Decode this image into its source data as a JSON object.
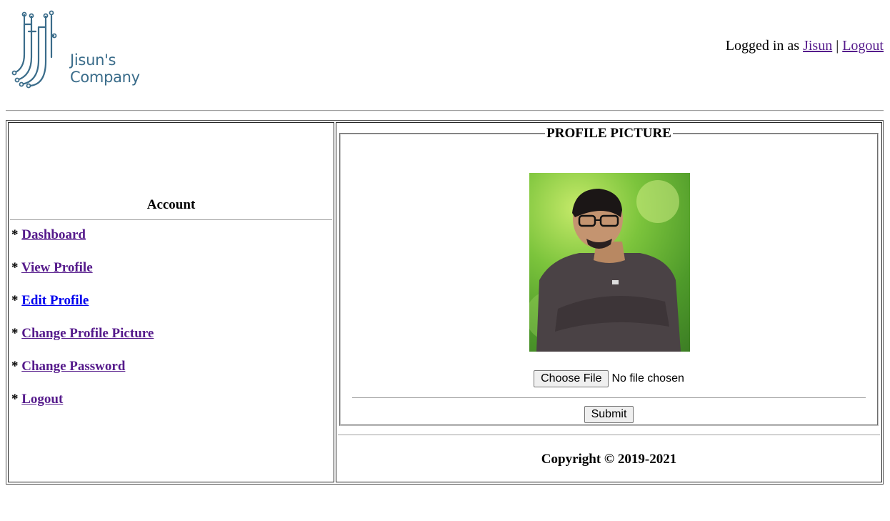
{
  "header": {
    "company_name": "Jisun's Company",
    "logged_in_prefix": "Logged in as",
    "username": "Jisun",
    "separator": "|",
    "logout_label": "Logout"
  },
  "sidebar": {
    "title": "Account",
    "bullet": "*",
    "items": [
      {
        "label": "Dashboard"
      },
      {
        "label": "View Profile"
      },
      {
        "label": "Edit Profile"
      },
      {
        "label": "Change Profile Picture"
      },
      {
        "label": "Change Password"
      },
      {
        "label": "Logout"
      }
    ]
  },
  "main": {
    "legend": "PROFILE PICTURE",
    "choose_file_label": "Choose File",
    "no_file_text": "No file chosen",
    "submit_label": "Submit"
  },
  "footer": {
    "copyright": "Copyright © 2019-2021"
  },
  "colors": {
    "link_visited": "#551a8b",
    "link_active": "#0000ee",
    "logo_blue": "#3a6c8a"
  }
}
